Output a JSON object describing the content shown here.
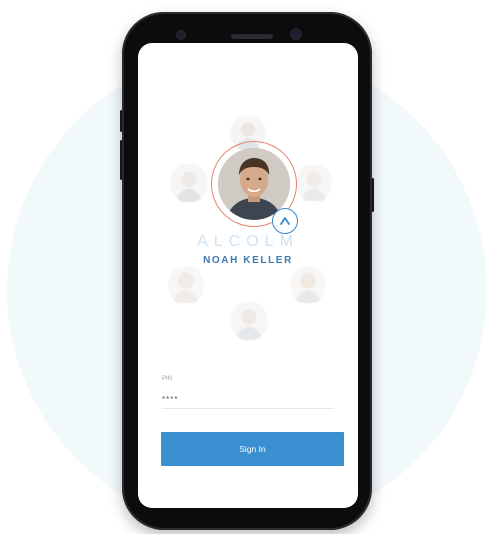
{
  "brand": {
    "name": "ALCOLM",
    "color": "#cfe3f3"
  },
  "user": {
    "name": "NOAH KELLER",
    "avatar": "face-photo"
  },
  "pin": {
    "label": "PIN",
    "value": "****"
  },
  "actions": {
    "signin_label": "Sign In"
  },
  "colors": {
    "accent": "#3a8fd1",
    "ring": "#e8846a",
    "name": "#3f79b2"
  },
  "icons": {
    "badge": "chevron-up-icon"
  }
}
